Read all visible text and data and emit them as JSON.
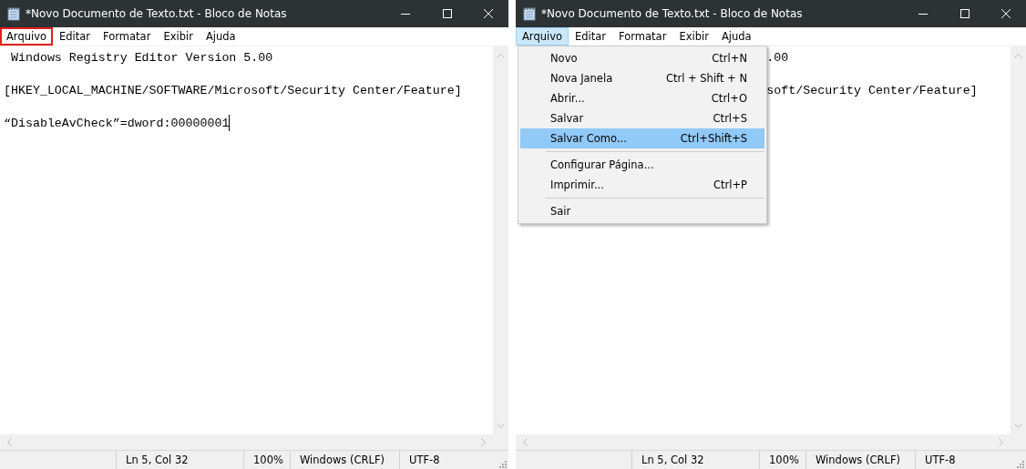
{
  "windows": [
    {
      "title": "*Novo Documento de Texto.txt - Bloco de Notas",
      "menu_bar": [
        {
          "label": "Arquivo",
          "open": false,
          "annotated": true
        },
        {
          "label": "Editar",
          "open": false,
          "annotated": false
        },
        {
          "label": "Formatar",
          "open": false,
          "annotated": false
        },
        {
          "label": "Exibir",
          "open": false,
          "annotated": false
        },
        {
          "label": "Ajuda",
          "open": false,
          "annotated": false
        }
      ],
      "lines": [
        {
          "text": " Windows Registry Editor Version 5.00",
          "cursor": false,
          "covered": false
        },
        {
          "text": "[HKEY_LOCAL_MACHINE/SOFTWARE/Microsoft/Security Center/Feature]",
          "cursor": false,
          "covered": false
        },
        {
          "text": "“DisableAvCheck”=dword:00000001",
          "cursor": true,
          "covered": false
        }
      ],
      "status_bar": [
        "Ln 5, Col 32",
        "100%",
        "Windows (CRLF)",
        "UTF-8"
      ]
    },
    {
      "title": "*Novo Documento de Texto.txt - Bloco de Notas",
      "menu_bar": [
        {
          "label": "Arquivo",
          "open": true,
          "annotated": false
        },
        {
          "label": "Editar",
          "open": false,
          "annotated": false
        },
        {
          "label": "Formatar",
          "open": false,
          "annotated": false
        },
        {
          "label": "Exibir",
          "open": false,
          "annotated": false
        },
        {
          "label": "Ajuda",
          "open": false,
          "annotated": false
        }
      ],
      "lines": [
        {
          "text": ".00",
          "cursor": false,
          "covered": true
        },
        {
          "text": "soft/Security Center/Feature]",
          "cursor": false,
          "covered": true
        }
      ],
      "dropdown_menu": [
        {
          "kind": "item",
          "label": "Novo",
          "shortcut": "Ctrl+N",
          "selected": false
        },
        {
          "kind": "item",
          "label": "Nova Janela",
          "shortcut": "Ctrl + Shift + N",
          "selected": false
        },
        {
          "kind": "item",
          "label": "Abrir...",
          "shortcut": "Ctrl+O",
          "selected": false
        },
        {
          "kind": "item",
          "label": "Salvar",
          "shortcut": "Ctrl+S",
          "selected": false
        },
        {
          "kind": "item",
          "label": "Salvar Como...",
          "shortcut": "Ctrl+Shift+S",
          "selected": true
        },
        {
          "kind": "separator"
        },
        {
          "kind": "item",
          "label": "Configurar Página...",
          "selected": false
        },
        {
          "kind": "item",
          "label": "Imprimir...",
          "shortcut": "Ctrl+P",
          "selected": false
        },
        {
          "kind": "separator"
        },
        {
          "kind": "item",
          "label": "Sair",
          "selected": false
        }
      ],
      "status_bar": [
        "Ln 5, Col 32",
        "100%",
        "Windows (CRLF)",
        "UTF-8"
      ]
    }
  ]
}
